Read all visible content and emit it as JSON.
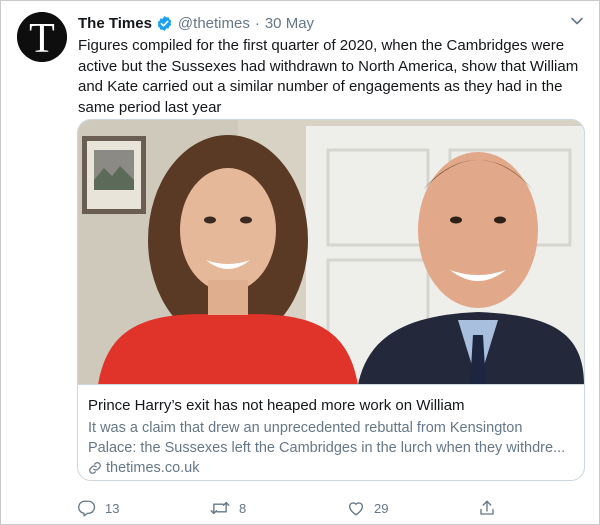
{
  "tweet": {
    "author": "The Times",
    "handle": "@thetimes",
    "separator": "·",
    "date": "30 May",
    "text": "Figures compiled for the first quarter of 2020, when the Cambridges were active but the Sussexes had withdrawn to North America, show that William and Kate carried out a similar number of engagements as they had in the same period last year",
    "avatar_letter": "T",
    "verified_color": "#1da1f2"
  },
  "card": {
    "title": "Prince Harry’s exit has not heaped more work on William",
    "description_line1": "It was a claim that drew an unprecedented rebuttal from Kensington",
    "description_line2": "Palace: the Sussexes left the Cambridges in the lurch when they withdre...",
    "domain": "thetimes.co.uk",
    "image_subject": "photo-two-people-smiling-video-call"
  },
  "actions": {
    "reply_count": "13",
    "retweet_count": "8",
    "like_count": "29"
  },
  "icons": {
    "verified": "verified-badge-icon",
    "caret": "chevron-down-icon",
    "link": "link-icon",
    "reply": "reply-icon",
    "retweet": "retweet-icon",
    "like": "heart-icon",
    "share": "share-icon"
  }
}
